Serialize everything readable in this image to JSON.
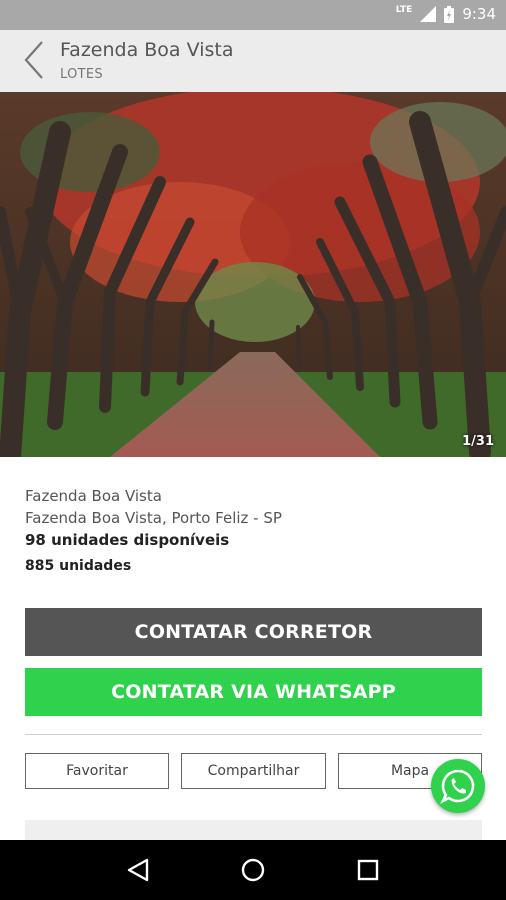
{
  "status_bar": {
    "network": "LTE",
    "time": "9:34"
  },
  "app_bar": {
    "title": "Fazenda Boa Vista",
    "subtitle": "LOTES"
  },
  "gallery": {
    "counter": "1/31"
  },
  "listing": {
    "name": "Fazenda Boa Vista",
    "location": "Fazenda Boa Vista, Porto Feliz - SP",
    "available": "98 unidades disponíveis",
    "total": "885 unidades"
  },
  "actions": {
    "contact_broker": "CONTATAR CORRETOR",
    "contact_whatsapp": "CONTATAR VIA WHATSAPP",
    "favorite": "Favoritar",
    "share": "Compartilhar",
    "map": "Mapa"
  },
  "colors": {
    "primary_dark": "#555555",
    "whatsapp_green": "#2fd14d"
  }
}
